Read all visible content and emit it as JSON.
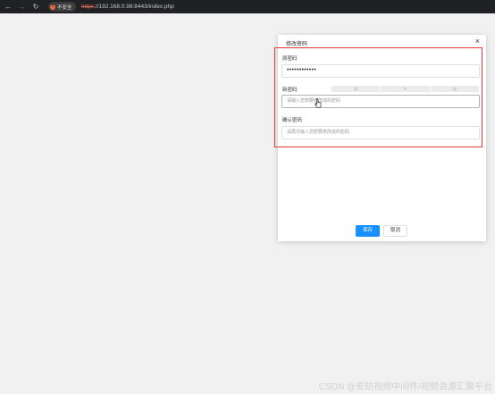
{
  "browser": {
    "security_label": "不安全",
    "url_scheme": "https",
    "url_rest": "://192.168.0.98:8443/index.php"
  },
  "dialog": {
    "title": "修改密码",
    "close_symbol": "×",
    "old_password": {
      "label": "原密码",
      "value": "••••••••••••"
    },
    "new_password": {
      "label": "新密码",
      "placeholder": "请输入您想要修改成的密码",
      "strength_levels": [
        "弱",
        "中",
        "强"
      ]
    },
    "confirm_password": {
      "label": "确认密码",
      "placeholder": "请再次输入您想要修改成的密码"
    },
    "save_label": "保存",
    "cancel_label": "取消"
  },
  "watermark": "CSDN @安防视频中间件/视频资源汇聚平台"
}
